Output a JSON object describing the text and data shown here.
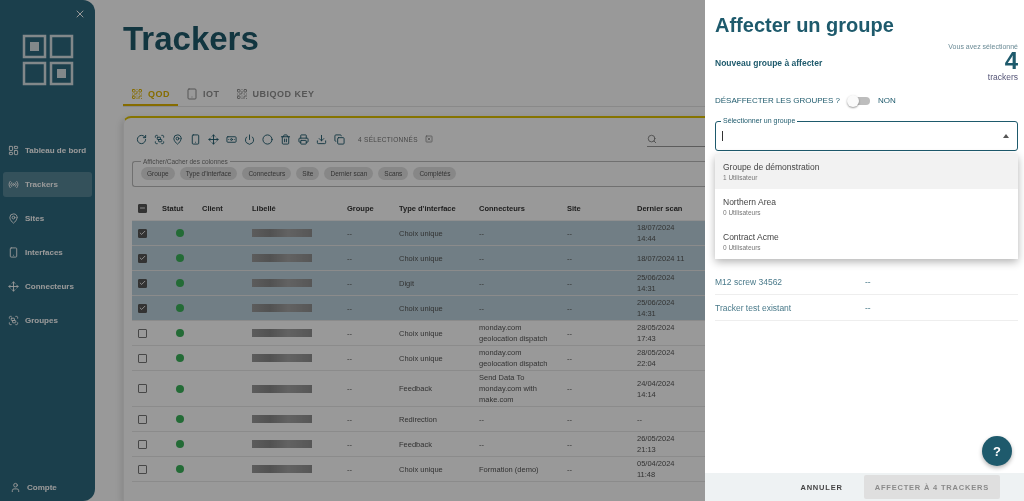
{
  "sidebar": {
    "items": [
      {
        "label": "Tableau de bord",
        "kind": "dashboard",
        "selected": false
      },
      {
        "label": "Trackers",
        "kind": "trackers",
        "selected": true
      },
      {
        "label": "Sites",
        "kind": "sites",
        "selected": false
      },
      {
        "label": "Interfaces",
        "kind": "interfaces",
        "selected": false
      },
      {
        "label": "Connecteurs",
        "kind": "connectors",
        "selected": false
      },
      {
        "label": "Groupes",
        "kind": "groups",
        "selected": false
      }
    ],
    "account": "Compte"
  },
  "page_title": "Trackers",
  "tabs": [
    {
      "label": "QOD",
      "kind": "qr",
      "selected": true
    },
    {
      "label": "IOT",
      "kind": "iot",
      "selected": false
    },
    {
      "label": "UBIQOD KEY",
      "kind": "key",
      "selected": false
    }
  ],
  "toolbar": {
    "selection_count": "4 SÉLECTIONNÉS"
  },
  "column_chooser": {
    "legend": "Afficher/Cacher des colonnes",
    "chips": [
      "Groupe",
      "Type d'interface",
      "Connecteurs",
      "Site",
      "Dernier scan",
      "Scans",
      "Complétés"
    ]
  },
  "table": {
    "select_all_indeterminate": true,
    "columns": [
      "Statut",
      "Client",
      "Libellé",
      "Groupe",
      "Type d'interface",
      "Connecteurs",
      "Site",
      "Dernier scan"
    ],
    "rows": [
      {
        "checked": true,
        "active": true,
        "groupe": "--",
        "type": "Choix unique",
        "connecteurs": "--",
        "site": "--",
        "dernier_scan": "18/07/2024\n14:44"
      },
      {
        "checked": true,
        "active": true,
        "groupe": "--",
        "type": "Choix unique",
        "connecteurs": "--",
        "site": "--",
        "dernier_scan": "18/07/2024 11"
      },
      {
        "checked": true,
        "active": true,
        "groupe": "--",
        "type": "Digit",
        "connecteurs": "--",
        "site": "--",
        "dernier_scan": "25/06/2024\n14:31"
      },
      {
        "checked": true,
        "active": true,
        "groupe": "--",
        "type": "Choix unique",
        "connecteurs": "--",
        "site": "--",
        "dernier_scan": "25/06/2024\n14:31"
      },
      {
        "checked": false,
        "active": true,
        "groupe": "--",
        "type": "Choix unique",
        "connecteurs": "monday.com\ngeolocation dispatch",
        "site": "--",
        "dernier_scan": "28/05/2024\n17:43"
      },
      {
        "checked": false,
        "active": true,
        "groupe": "--",
        "type": "Choix unique",
        "connecteurs": "monday.com\ngeolocation dispatch",
        "site": "--",
        "dernier_scan": "28/05/2024\n22:04"
      },
      {
        "checked": false,
        "active": true,
        "groupe": "--",
        "type": "Feedback",
        "connecteurs": "Send Data To\nmonday.com with\nmake.com",
        "site": "--",
        "dernier_scan": "24/04/2024\n14:14"
      },
      {
        "checked": false,
        "active": true,
        "groupe": "--",
        "type": "Redirection",
        "connecteurs": "--",
        "site": "--",
        "dernier_scan": "--"
      },
      {
        "checked": false,
        "active": true,
        "groupe": "--",
        "type": "Feedback",
        "connecteurs": "--",
        "site": "--",
        "dernier_scan": "26/05/2024\n21:13"
      },
      {
        "checked": false,
        "active": true,
        "groupe": "--",
        "type": "Choix unique",
        "connecteurs": "Formation (demo)",
        "site": "--",
        "dernier_scan": "05/04/2024\n11:48"
      }
    ]
  },
  "drawer": {
    "title": "Affecter un groupe",
    "selection_note": "Vous avez sélectionné",
    "selection_count": "4",
    "selection_unit": "trackers",
    "subtitle": "Nouveau groupe à affecter",
    "unassign": {
      "label": "DÉSAFFECTER LES GROUPES ?",
      "on": false,
      "value_text": "NON"
    },
    "group_select": {
      "label": "Sélectionner un groupe",
      "expanded": true,
      "options": [
        {
          "name": "Groupe de démonstration",
          "users": "1 Utilisateur",
          "selected": true
        },
        {
          "name": "Northern Area",
          "users": "0 Utilisateurs",
          "selected": false
        },
        {
          "name": "Contract Acme",
          "users": "0 Utilisateurs",
          "selected": false
        }
      ]
    },
    "trackers": [
      {
        "name": "M12 screw 34562",
        "group": "--"
      },
      {
        "name": "Tracker test existant",
        "group": "--"
      }
    ],
    "buttons": {
      "cancel": "ANNULER",
      "submit": {
        "label": "AFFECTER À 4 TRACKERS",
        "disabled": true
      }
    },
    "help": "?"
  }
}
